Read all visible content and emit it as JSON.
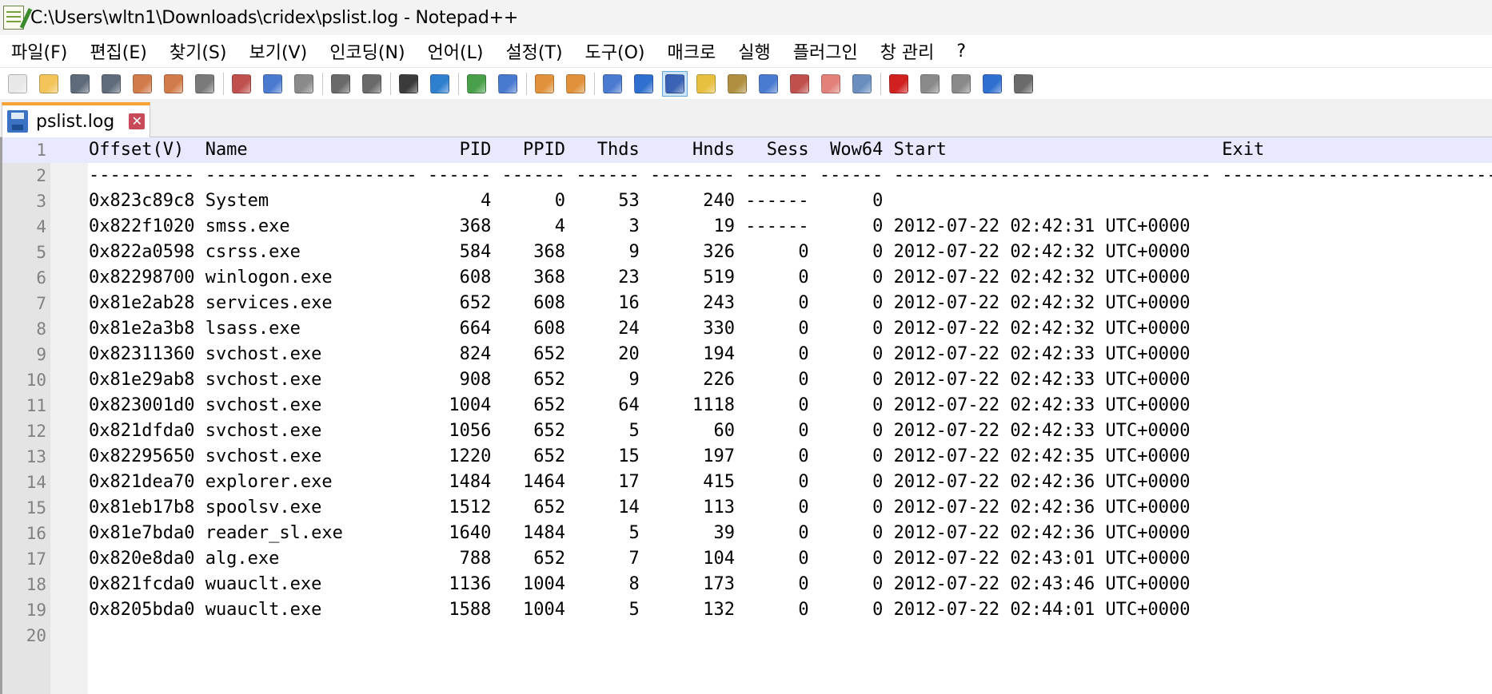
{
  "window": {
    "title": "C:\\Users\\wltn1\\Downloads\\cridex\\pslist.log - Notepad++"
  },
  "menu": [
    "파일(F)",
    "편집(E)",
    "찾기(S)",
    "보기(V)",
    "인코딩(N)",
    "언어(L)",
    "설정(T)",
    "도구(O)",
    "매크로",
    "실행",
    "플러그인",
    "창 관리",
    "?"
  ],
  "toolbar": {
    "buttons": [
      {
        "icon": "new-file-icon",
        "color": "#e8e8e8"
      },
      {
        "icon": "open-file-icon",
        "color": "#f2c45a"
      },
      {
        "icon": "save-icon",
        "color": "#5f6b7a"
      },
      {
        "icon": "save-all-icon",
        "color": "#5f6b7a"
      },
      {
        "icon": "close-icon",
        "color": "#d27b4a"
      },
      {
        "icon": "close-all-icon",
        "color": "#d27b4a"
      },
      {
        "icon": "print-icon",
        "color": "#7a7a7a"
      },
      {
        "sep": true
      },
      {
        "icon": "cut-icon",
        "color": "#c0504d"
      },
      {
        "icon": "copy-icon",
        "color": "#4b7bd1"
      },
      {
        "icon": "paste-icon",
        "color": "#8a8a8a"
      },
      {
        "sep": true
      },
      {
        "icon": "undo-icon",
        "color": "#6a6a6a"
      },
      {
        "icon": "redo-icon",
        "color": "#6a6a6a"
      },
      {
        "sep": true
      },
      {
        "icon": "find-icon",
        "color": "#3b3b3b"
      },
      {
        "icon": "replace-icon",
        "color": "#2f7fcf"
      },
      {
        "sep": true
      },
      {
        "icon": "zoom-in-icon",
        "color": "#4aa04a"
      },
      {
        "icon": "zoom-out-icon",
        "color": "#4a7ad0"
      },
      {
        "sep": true
      },
      {
        "icon": "sync-vertical-icon",
        "color": "#e0913a"
      },
      {
        "icon": "sync-horizontal-icon",
        "color": "#e0913a"
      },
      {
        "sep": true
      },
      {
        "icon": "word-wrap-icon",
        "color": "#4b7bd1"
      },
      {
        "icon": "show-all-chars-icon",
        "color": "#2f6fcf"
      },
      {
        "icon": "indent-guide-icon",
        "color": "#3a63b5",
        "active": true
      },
      {
        "icon": "language-icon",
        "color": "#e8c040"
      },
      {
        "icon": "doc-map-icon",
        "color": "#b09040"
      },
      {
        "icon": "doc-list-icon",
        "color": "#4b7bd1"
      },
      {
        "icon": "function-list-icon",
        "color": "#c0504d"
      },
      {
        "icon": "folder-workspace-icon",
        "color": "#e2807a"
      },
      {
        "icon": "monitoring-icon",
        "color": "#6a8fbf"
      },
      {
        "sep": true
      },
      {
        "icon": "record-macro-icon",
        "color": "#d02020"
      },
      {
        "icon": "stop-macro-icon",
        "color": "#8a8a8a"
      },
      {
        "icon": "play-macro-icon",
        "color": "#8a8a8a"
      },
      {
        "icon": "run-macro-multiple-icon",
        "color": "#2f6fcf"
      },
      {
        "icon": "save-macro-icon",
        "color": "#6a6a6a"
      }
    ]
  },
  "tab": {
    "label": "pslist.log",
    "close": "✕"
  },
  "editor": {
    "lines": [
      {
        "n": "1",
        "text": "Offset(V)  Name                    PID   PPID   Thds     Hnds   Sess  Wow64 Start                          Exit"
      },
      {
        "n": "2",
        "text": "---------- -------------------- ------ ------ ------ -------- ------ ------ ------------------------------ ------------------------------"
      },
      {
        "n": "3",
        "text": "0x823c89c8 System                    4      0     53      240 ------      0"
      },
      {
        "n": "4",
        "text": "0x822f1020 smss.exe                368      4      3       19 ------      0 2012-07-22 02:42:31 UTC+0000"
      },
      {
        "n": "5",
        "text": "0x822a0598 csrss.exe               584    368      9      326      0      0 2012-07-22 02:42:32 UTC+0000"
      },
      {
        "n": "6",
        "text": "0x82298700 winlogon.exe            608    368     23      519      0      0 2012-07-22 02:42:32 UTC+0000"
      },
      {
        "n": "7",
        "text": "0x81e2ab28 services.exe            652    608     16      243      0      0 2012-07-22 02:42:32 UTC+0000"
      },
      {
        "n": "8",
        "text": "0x81e2a3b8 lsass.exe               664    608     24      330      0      0 2012-07-22 02:42:32 UTC+0000"
      },
      {
        "n": "9",
        "text": "0x82311360 svchost.exe             824    652     20      194      0      0 2012-07-22 02:42:33 UTC+0000"
      },
      {
        "n": "10",
        "text": "0x81e29ab8 svchost.exe             908    652      9      226      0      0 2012-07-22 02:42:33 UTC+0000"
      },
      {
        "n": "11",
        "text": "0x823001d0 svchost.exe            1004    652     64     1118      0      0 2012-07-22 02:42:33 UTC+0000"
      },
      {
        "n": "12",
        "text": "0x821dfda0 svchost.exe            1056    652      5       60      0      0 2012-07-22 02:42:33 UTC+0000"
      },
      {
        "n": "13",
        "text": "0x82295650 svchost.exe            1220    652     15      197      0      0 2012-07-22 02:42:35 UTC+0000"
      },
      {
        "n": "14",
        "text": "0x821dea70 explorer.exe           1484   1464     17      415      0      0 2012-07-22 02:42:36 UTC+0000"
      },
      {
        "n": "15",
        "text": "0x81eb17b8 spoolsv.exe            1512    652     14      113      0      0 2012-07-22 02:42:36 UTC+0000"
      },
      {
        "n": "16",
        "text": "0x81e7bda0 reader_sl.exe          1640   1484      5       39      0      0 2012-07-22 02:42:36 UTC+0000"
      },
      {
        "n": "17",
        "text": "0x820e8da0 alg.exe                 788    652      7      104      0      0 2012-07-22 02:43:01 UTC+0000"
      },
      {
        "n": "18",
        "text": "0x821fcda0 wuauclt.exe            1136   1004      8      173      0      0 2012-07-22 02:43:46 UTC+0000"
      },
      {
        "n": "19",
        "text": "0x8205bda0 wuauclt.exe            1588   1004      5      132      0      0 2012-07-22 02:44:01 UTC+0000"
      },
      {
        "n": "20",
        "text": ""
      }
    ]
  }
}
